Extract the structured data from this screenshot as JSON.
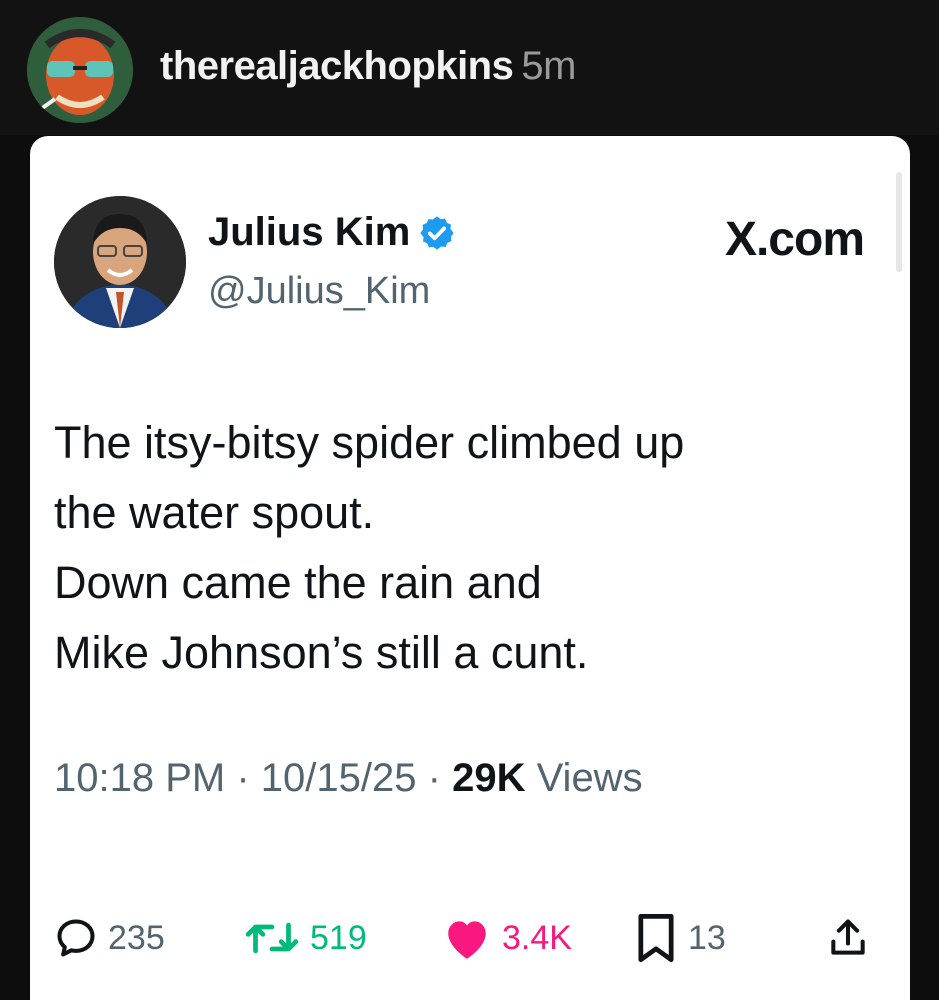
{
  "top": {
    "username": "therealjackhopkins",
    "time": "5m"
  },
  "tweet": {
    "author_name": "Julius Kim",
    "author_handle": "@Julius_Kim",
    "source": "X.com",
    "lines": [
      "The itsy-bitsy spider climbed up",
      "the water spout.",
      "Down came the rain and",
      "Mike Johnson’s still a cunt."
    ],
    "time": "10:18 PM",
    "date": "10/15/25",
    "views_count": "29K",
    "views_label": "Views",
    "separator": "·"
  },
  "actions": {
    "replies": "235",
    "reposts": "519",
    "likes": "3.4K",
    "bookmarks": "13"
  },
  "colors": {
    "repost": "#00ba7c",
    "like": "#f91880",
    "verified": "#1d9bf0",
    "muted": "#536471"
  }
}
